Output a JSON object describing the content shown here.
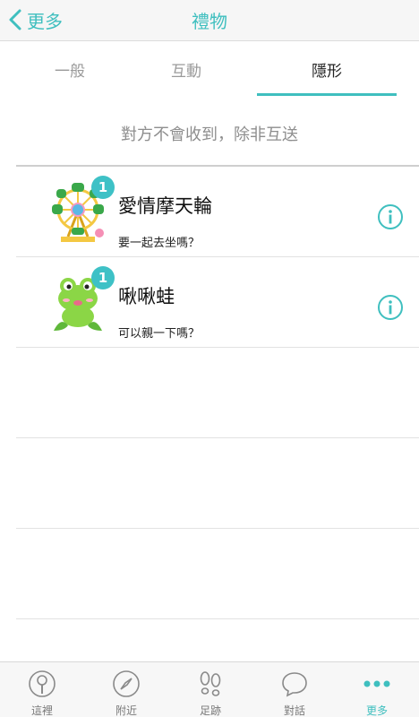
{
  "nav": {
    "back_label": "更多",
    "title": "禮物"
  },
  "tabs": [
    {
      "label": "一般",
      "active": false
    },
    {
      "label": "互動",
      "active": false
    },
    {
      "label": "隱形",
      "active": true
    }
  ],
  "hint": "對方不會收到，除非互送",
  "gifts": [
    {
      "icon": "ferris-wheel-icon",
      "count": "1",
      "name": "愛情摩天輪",
      "desc": "要一起去坐嗎？"
    },
    {
      "icon": "frog-icon",
      "count": "1",
      "name": "啾啾蛙",
      "desc": "可以親一下嗎？"
    }
  ],
  "tabbar": [
    {
      "label": "這裡",
      "icon": "location-pin-icon"
    },
    {
      "label": "附近",
      "icon": "compass-icon"
    },
    {
      "label": "足跡",
      "icon": "footprints-icon"
    },
    {
      "label": "對話",
      "icon": "chat-bubble-icon"
    },
    {
      "label": "更多",
      "icon": "more-dots-icon",
      "active": true
    }
  ],
  "colors": {
    "accent": "#3fbfbf",
    "badge": "#3ec1c6"
  }
}
